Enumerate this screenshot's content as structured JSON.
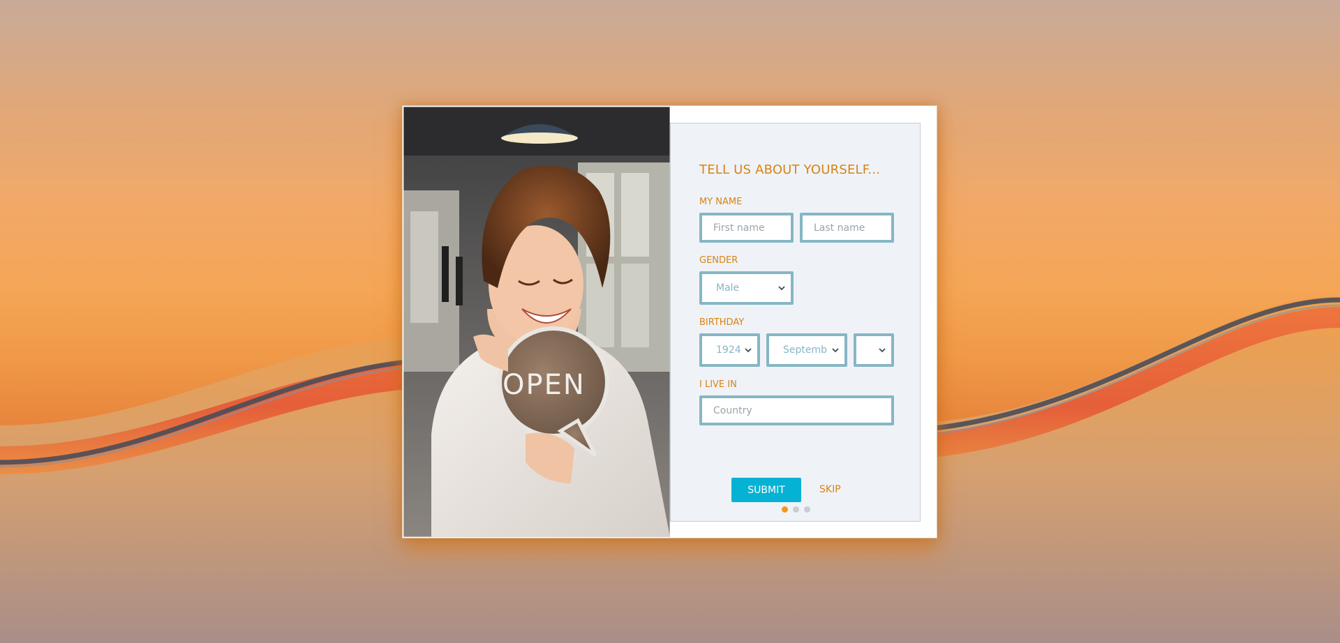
{
  "form": {
    "heading": "TELL US ABOUT YOURSELF...",
    "name_label": "MY NAME",
    "first_name_placeholder": "First name",
    "last_name_placeholder": "Last name",
    "gender_label": "GENDER",
    "gender_value": "Male",
    "birthday_label": "BIRTHDAY",
    "birthday_year": "1924",
    "birthday_month": "Septemb",
    "birthday_day": "",
    "country_label": "I LIVE IN",
    "country_placeholder": "Country",
    "submit_label": "SUBMIT",
    "skip_label": "SKIP"
  },
  "photo": {
    "sign_text": "OPEN"
  },
  "pagination": {
    "total": 3,
    "active": 1
  },
  "colors": {
    "accent_orange": "#d98212",
    "field_border": "#86b6c4",
    "submit_bg": "#05b2d4",
    "panel_bg": "#eff3f8",
    "dot_active": "#f09a1a",
    "dot_inactive": "#c9ccd2"
  }
}
